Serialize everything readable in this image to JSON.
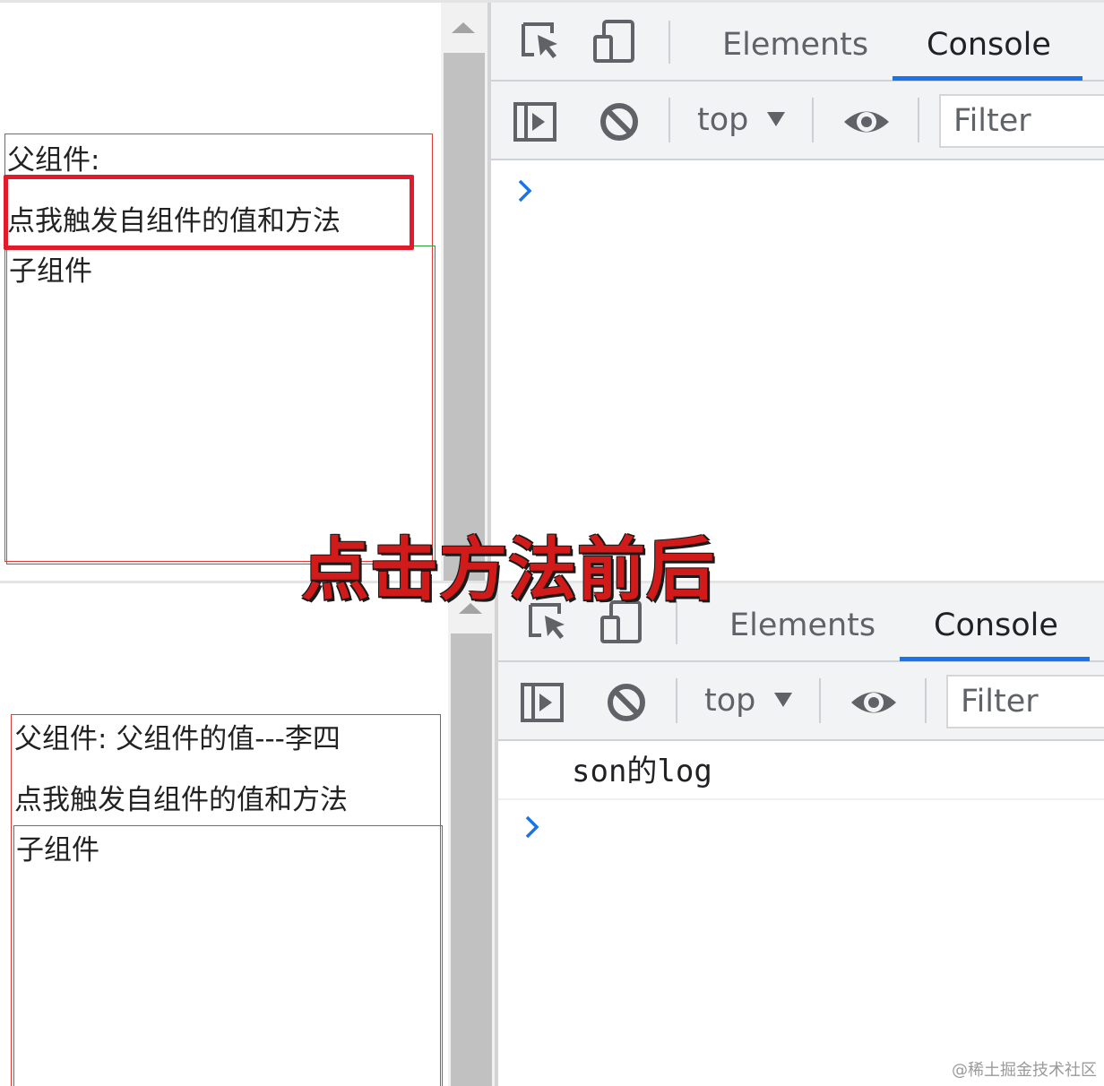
{
  "devtools": {
    "tabs": [
      {
        "label": "Elements",
        "active": false
      },
      {
        "label": "Console",
        "active": true
      }
    ],
    "context": "top",
    "filter_placeholder": "Filter",
    "accent_color": "#1a73e8",
    "icons": [
      "inspect-element-icon",
      "device-toolbar-icon",
      "show-sidebar-icon",
      "clear-console-icon",
      "live-expression-eye-icon"
    ]
  },
  "before": {
    "parent_label": "父组件:",
    "button_text": "点我触发自组件的值和方法",
    "child_label": "子组件",
    "console_lines": []
  },
  "after": {
    "parent_label": "父组件: 父组件的值---李四",
    "button_text": "点我触发自组件的值和方法",
    "child_label": "子组件",
    "console_lines": [
      "son的log"
    ]
  },
  "colors": {
    "parent_border": "#e53935",
    "child_border": "#2e9a3e",
    "highlight": "#e21b2c"
  },
  "overlay_caption": "点击方法前后",
  "watermark": "@稀土掘金技术社区"
}
